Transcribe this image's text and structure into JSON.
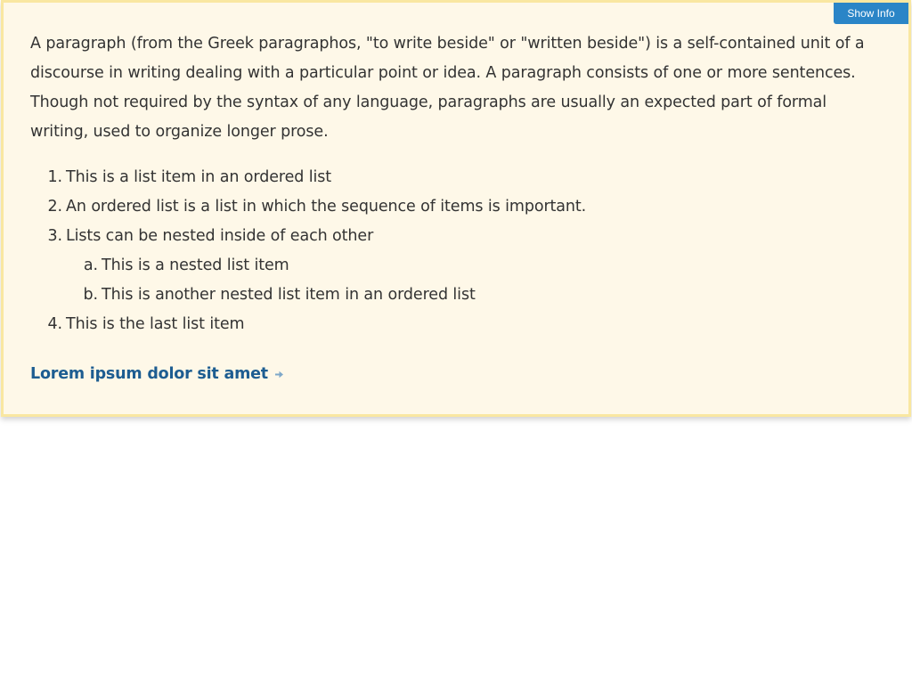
{
  "header": {
    "show_info_label": "Show Info"
  },
  "content": {
    "paragraph": "A paragraph (from the Greek paragraphos, \"to write beside\" or \"written beside\") is a self-contained unit of a discourse in writing dealing with a particular point or idea. A paragraph consists of one or more sentences. Though not required by the syntax of any language, paragraphs are usually an expected part of formal writing, used to organize longer prose.",
    "list": [
      {
        "marker": "1.",
        "text": "This is a list item in an ordered list"
      },
      {
        "marker": "2.",
        "text": "An ordered list is a list in which the sequence of items is important."
      },
      {
        "marker": "3.",
        "text": "Lists can be nested inside of each other"
      },
      {
        "marker": "a.",
        "text": "This is a nested list item"
      },
      {
        "marker": "b.",
        "text": "This is another nested list item in an ordered list"
      },
      {
        "marker": "4.",
        "text": "This is the last list item"
      }
    ],
    "link_label": "Lorem ipsum dolor sit amet",
    "link_icon": "arrow-right-icon"
  },
  "colors": {
    "panel_background": "#fef8e8",
    "panel_border": "#f9e7a1",
    "button_blue": "#2a85c7",
    "link_blue": "#1d5d91",
    "arrow_gray": "#7fa8c9"
  }
}
